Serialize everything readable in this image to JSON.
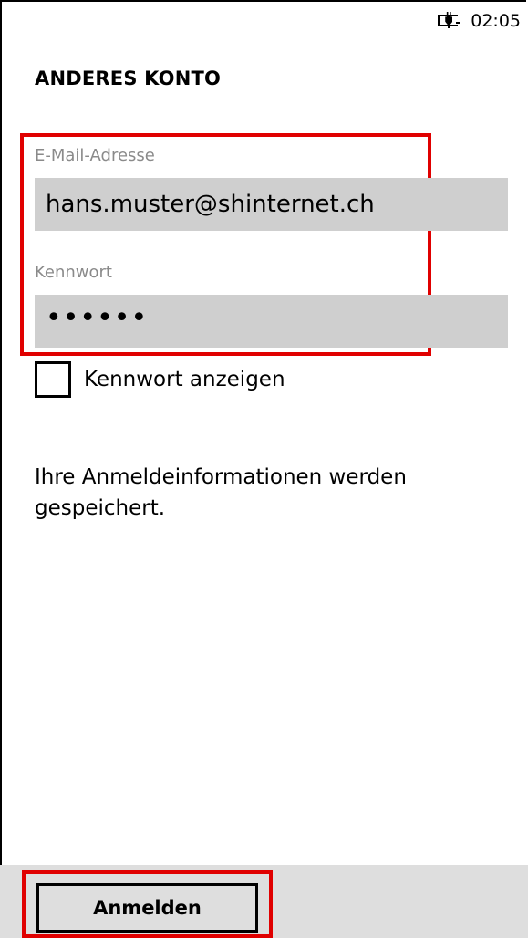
{
  "status_bar": {
    "battery_icon": "battery-charging-icon",
    "time": "02:05"
  },
  "page": {
    "title": "ANDERES KONTO"
  },
  "form": {
    "email": {
      "label": "E-Mail-Adresse",
      "value": "hans.muster@shinternet.ch"
    },
    "password": {
      "label": "Kennwort",
      "value": "••••••"
    },
    "show_password": {
      "label": "Kennwort anzeigen",
      "checked": false
    }
  },
  "info": {
    "text": "Ihre Anmeldeinformationen werden gespeichert."
  },
  "app_bar": {
    "login_label": "Anmelden"
  },
  "colors": {
    "highlight": "#e00000",
    "field_background": "#cfcfcf",
    "label_gray": "#8a8a8a",
    "app_bar_background": "#dedede"
  }
}
